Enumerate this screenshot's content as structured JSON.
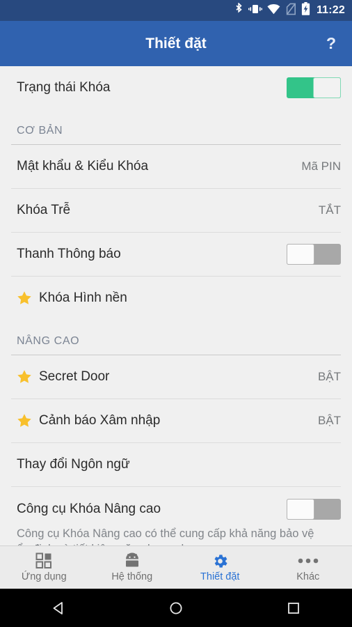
{
  "statusbar": {
    "time": "11:22",
    "icons": [
      "bluetooth-icon",
      "vibrate-icon",
      "wifi-warning-icon",
      "no-sim-icon",
      "battery-charging-icon"
    ]
  },
  "appbar": {
    "title": "Thiết đặt",
    "help_label": "?",
    "background": "#3062af"
  },
  "list": {
    "master": {
      "label": "Trạng thái Khóa",
      "state": "on"
    },
    "sections": [
      {
        "header": "CƠ BẢN",
        "rows": [
          {
            "label": "Mật khẩu & Kiểu Khóa",
            "value": "Mã PIN"
          },
          {
            "label": "Khóa Trễ",
            "value": "TẮT"
          },
          {
            "label": "Thanh Thông báo",
            "toggle": "off"
          },
          {
            "label": "Khóa Hình nền",
            "star": true
          }
        ]
      },
      {
        "header": "NÂNG CAO",
        "rows": [
          {
            "label": "Secret Door",
            "value": "BẬT",
            "star": true
          },
          {
            "label": "Cảnh báo Xâm nhập",
            "value": "BẬT",
            "star": true
          },
          {
            "label": "Thay đổi Ngôn ngữ"
          },
          {
            "label": "Công cụ Khóa Nâng cao",
            "toggle": "off",
            "description": "Công cụ Khóa Nâng cao có thể cung cấp khả năng bảo vệ ổn định và tiết kiệm năng lượng hơn"
          }
        ]
      }
    ]
  },
  "tabbar": {
    "tabs": [
      {
        "label": "Ứng dụng",
        "icon": "apps-grid-icon",
        "active": false
      },
      {
        "label": "Hệ thống",
        "icon": "android-robot-icon",
        "active": false
      },
      {
        "label": "Thiết đặt",
        "icon": "gear-icon",
        "active": true
      },
      {
        "label": "Khác",
        "icon": "more-dots-icon",
        "active": false
      }
    ],
    "active_color": "#2a72d4"
  },
  "navbar": {
    "buttons": [
      "back-icon",
      "home-icon",
      "recents-icon"
    ]
  },
  "colors": {
    "accent_blue": "#3062af",
    "status_blue": "#28497f",
    "toggle_on_green": "#33c489",
    "star_gold": "#f8c02c",
    "background": "#f0f0f0"
  }
}
